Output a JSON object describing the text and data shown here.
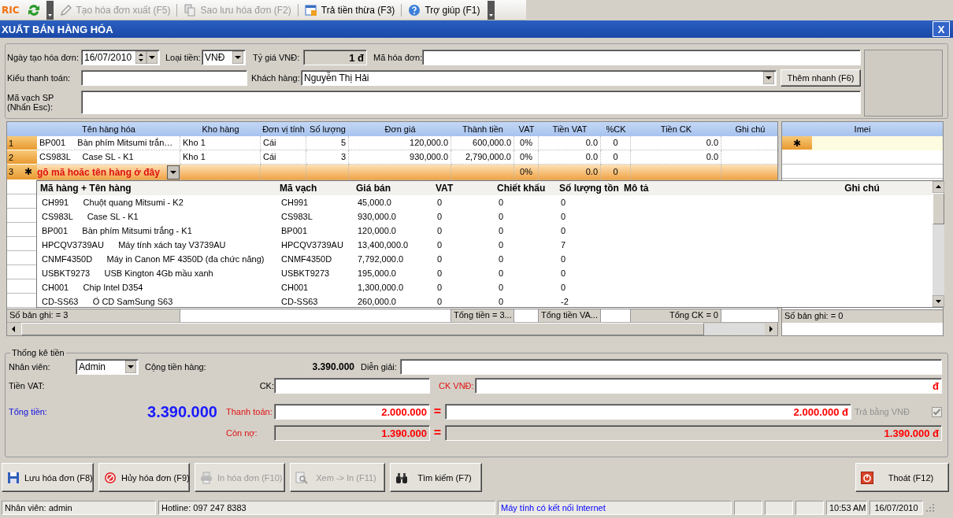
{
  "toolbar": {
    "logo": "RIC",
    "items": [
      {
        "label": "Tạo hóa đơn xuất (F5)",
        "disabled": true
      },
      {
        "label": "Sao lưu hóa đơn (F2)",
        "disabled": true
      },
      {
        "label": "Trả tiền thừa (F3)",
        "disabled": false
      },
      {
        "label": "Trợ giúp (F1)",
        "disabled": false
      }
    ]
  },
  "window": {
    "title": "XUẤT BÁN HÀNG HÓA",
    "close": "X"
  },
  "form": {
    "date_label": "Ngày tạo hóa đơn:",
    "date": "16/07/2010",
    "currency_label": "Loại tiền:",
    "currency": "VNĐ",
    "rate_label": "Tỷ giá VNĐ:",
    "rate": "1 đ",
    "invoice_no_label": "Mã hóa đơn:",
    "payment_type_label": "Kiểu thanh toán:",
    "customer_label": "Khách hàng:",
    "customer": "Nguyễn Thị Hải",
    "quick_add_button": "Thêm nhanh (F6)",
    "barcode_label": "Mã vạch SP\n(Nhấn Esc):"
  },
  "items_table": {
    "columns": [
      "Tên hàng hóa",
      "Kho hàng",
      "Đơn vị tính",
      "Số lượng",
      "Đơn giá",
      "Thành tiền",
      "VAT",
      "Tiền VAT",
      "%CK",
      "Tiền CK",
      "Ghi chú"
    ],
    "rows": [
      {
        "number": "1",
        "selected": false,
        "cells": [
          "BP001     Bàn phím Mitsumi trắn…",
          "Kho 1",
          "Cái",
          "5",
          "120,000.0",
          "600,000.0",
          "0%",
          "0.0",
          "0",
          "0.0",
          null
        ]
      },
      {
        "number": "2",
        "selected": false,
        "cells": [
          "CS983L     Case SL - K1",
          "Kho 1",
          "Cái",
          "3",
          "930,000.0",
          "2,790,000.0",
          "0%",
          "0.0",
          "0",
          "0.0",
          null
        ]
      },
      {
        "number": "3",
        "selected": true,
        "marker": "✱",
        "editor": "gõ mã hoăc tên hàng ở đây",
        "cells": [
          null,
          null,
          null,
          null,
          null,
          null,
          "0%",
          "0.0",
          "0",
          null,
          null
        ]
      }
    ],
    "footer": [
      "Số bản ghi: = 3",
      "Tổng tiền = 3...",
      "Tổng tiền VA...",
      "Tổng CK = 0"
    ]
  },
  "product_dropdown": {
    "columns": [
      "Mã hàng + Tên hàng",
      "Mã vạch",
      "Giá bán",
      "VAT",
      "Chiết khấu",
      "Số lượng tồn",
      "Mô tả",
      "Ghi chú"
    ],
    "rows": [
      [
        "CH991      Chuột quang Mitsumi - K2",
        "CH991",
        "45,000.0",
        "0",
        "0",
        "0"
      ],
      [
        "CS983L      Case SL - K1",
        "CS983L",
        "930,000.0",
        "0",
        "0",
        "0"
      ],
      [
        "BP001      Bàn phím Mitsumi trắng - K1",
        "BP001",
        "120,000.0",
        "0",
        "0",
        "0"
      ],
      [
        "HPCQV3739AU      Máy tính xách tay V3739AU",
        "HPCQV3739AU",
        "13,400,000.0",
        "0",
        "0",
        "7"
      ],
      [
        "CNMF4350D      Máy in Canon MF 4350D (đa chức năng)",
        "CNMF4350D",
        "7,792,000.0",
        "0",
        "0",
        "0"
      ],
      [
        "USBKT9273      USB Kington 4Gb mầu xanh",
        "USBKT9273",
        "195,000.0",
        "0",
        "0",
        "0"
      ],
      [
        "CH001      Chip Intel D354",
        "CH001",
        "1,300,000.0",
        "0",
        "0",
        "0"
      ],
      [
        "CD-SS63      Ổ CD SamSung S63",
        "CD-SS63",
        "260,000.0",
        "0",
        "0",
        "-2"
      ]
    ]
  },
  "imei_table": {
    "column": "Imei",
    "marker": "✱",
    "footer": "Số bản ghi: = 0"
  },
  "totals": {
    "legend": "Thống kê tiền",
    "staff_label": "Nhân viên:",
    "staff": "Admin",
    "subtotal_label": "Cộng tiền hàng:",
    "subtotal": "3.390.000",
    "note_label": "Diễn giải:",
    "vat_label": "Tiền VAT:",
    "discount_label": "CK:",
    "discount_vnd_label": "CK VNĐ:",
    "discount_vnd_unit": "đ",
    "total_label": "Tổng tiền:",
    "total": "3.390.000",
    "paid_label": "Thanh toán:",
    "paid": "2.000.000",
    "paid_equals": "=",
    "paid_vnd": "2.000.000 đ",
    "pay_in_vnd_label": "Trả bằng VNĐ",
    "pay_in_vnd_checked": true,
    "pay_in_vnd_disabled": true,
    "debt_label": "Còn nợ:",
    "debt": "1.390.000",
    "debt_equals": "=",
    "debt_vnd": "1.390.000 đ"
  },
  "buttons": [
    {
      "label": "Lưu hóa đơn (F8)",
      "disabled": false
    },
    {
      "label": "Hủy hóa đơn (F9)",
      "disabled": false
    },
    {
      "label": "In hóa đơn (F10)",
      "disabled": true
    },
    {
      "label": "Xem -> In (F11)",
      "disabled": true
    },
    {
      "label": "Tìm kiếm (F7)",
      "disabled": false
    },
    {
      "label": "Thoát (F12)",
      "disabled": false
    }
  ],
  "status_bar": [
    {
      "text": "Nhân viên: admin",
      "color": "#000000"
    },
    {
      "text": "Hotline: 097 247 8383",
      "color": "#000000"
    },
    {
      "text": "Máy tính có kết nối Internet",
      "color": "#0000ff"
    },
    {
      "text": "10:53 AM",
      "color": "#000000"
    },
    {
      "text": "16/07/2010",
      "color": "#000000"
    }
  ]
}
